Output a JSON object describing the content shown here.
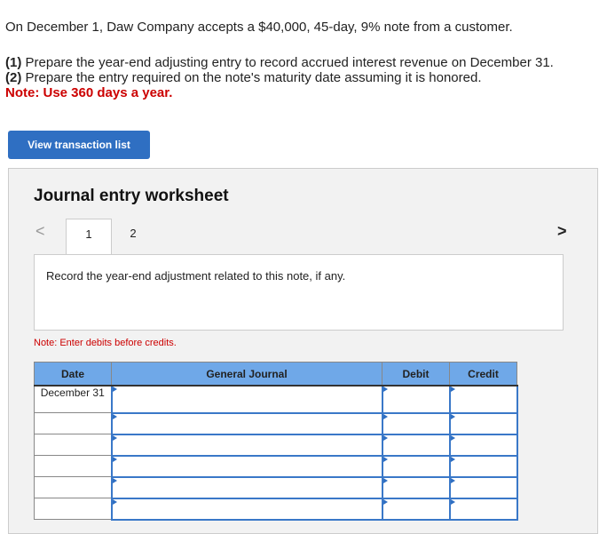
{
  "question": {
    "intro": "On December 1, Daw Company accepts a $40,000, 45-day, 9% note from a customer.",
    "part1_label": "(1)",
    "part1": " Prepare the year-end adjusting entry to record accrued interest revenue on December 31.",
    "part2_label": "(2)",
    "part2": " Prepare the entry required on the note's maturity date assuming it is honored.",
    "note": "Note: Use 360 days a year."
  },
  "view_button": "View transaction list",
  "worksheet": {
    "title": "Journal entry worksheet",
    "tabs": [
      "1",
      "2"
    ],
    "instruction": "Record the year-end adjustment related to this note, if any.",
    "note": "Note: Enter debits before credits.",
    "headers": [
      "Date",
      "General Journal",
      "Debit",
      "Credit"
    ],
    "rows": [
      {
        "date": "December 31"
      },
      {
        "date": ""
      },
      {
        "date": ""
      },
      {
        "date": ""
      },
      {
        "date": ""
      },
      {
        "date": ""
      }
    ]
  }
}
